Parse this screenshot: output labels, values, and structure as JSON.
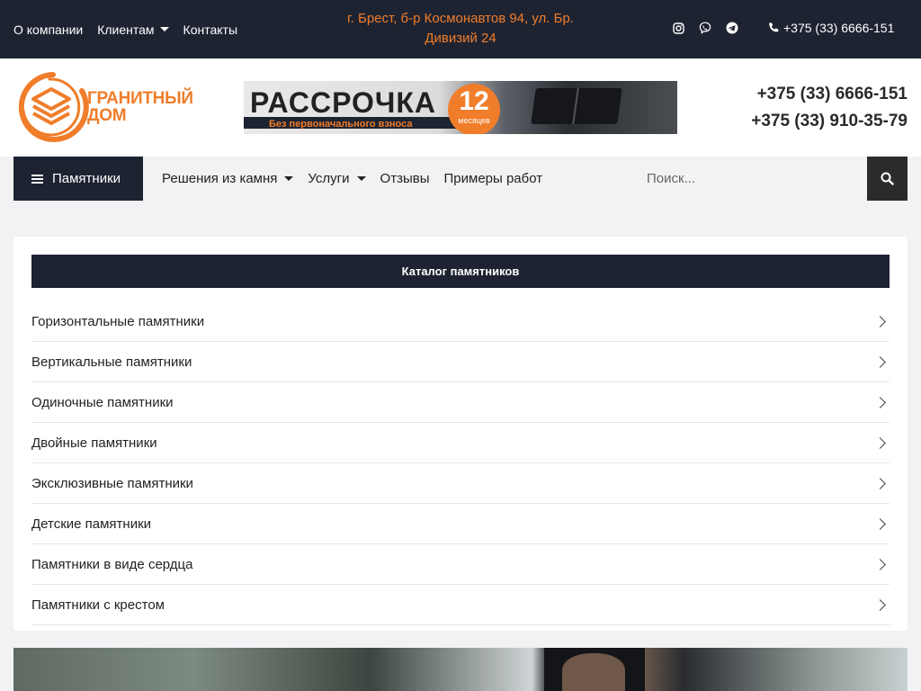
{
  "topbar": {
    "nav": [
      {
        "label": "О компании",
        "has_dropdown": false
      },
      {
        "label": "Клиентам",
        "has_dropdown": true
      },
      {
        "label": "Контакты",
        "has_dropdown": false
      }
    ],
    "address": "г. Брест, б-р Космонавтов 94, ул. Бр. Дивизий 24",
    "socials": [
      "instagram-icon",
      "viber-icon",
      "telegram-icon"
    ],
    "phone": "+375 (33) 6666-151"
  },
  "header": {
    "logo_line1": "ГРАНИТНЫЙ",
    "logo_line2": "ДОМ",
    "banner": {
      "title": "РАССРОЧКА",
      "subtitle": "Без первоначального взноса",
      "number": "12",
      "unit": "месяцев"
    },
    "phones": [
      "+375 (33) 6666-151",
      "+375 (33) 910-35-79"
    ]
  },
  "nav": {
    "catalog_button": "Памятники",
    "links": [
      {
        "label": "Решения из камня",
        "has_dropdown": true
      },
      {
        "label": "Услуги",
        "has_dropdown": true
      },
      {
        "label": "Отзывы",
        "has_dropdown": false
      },
      {
        "label": "Примеры работ",
        "has_dropdown": false
      }
    ],
    "search_placeholder": "Поиск..."
  },
  "catalog": {
    "title": "Каталог памятников",
    "items": [
      "Горизонтальные памятники",
      "Вертикальные памятники",
      "Одиночные памятники",
      "Двойные памятники",
      "Эксклюзивные памятники",
      "Детские памятники",
      "Памятники в виде сердца",
      "Памятники с крестом"
    ]
  },
  "colors": {
    "dark": "#1e2332",
    "accent": "#f07d2a"
  }
}
